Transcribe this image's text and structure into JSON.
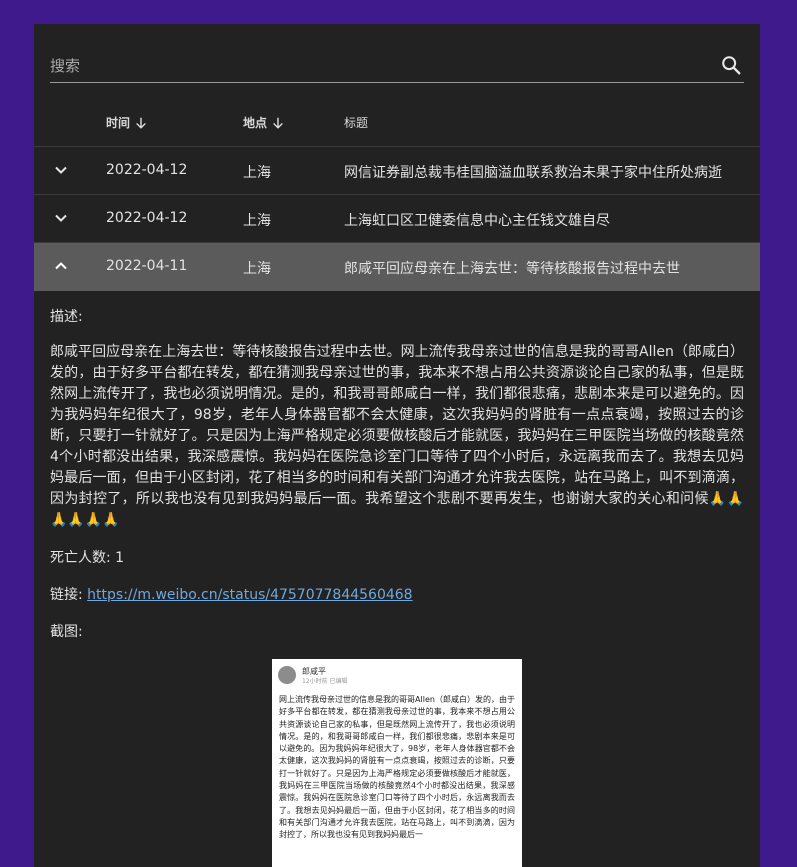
{
  "search": {
    "placeholder": "搜索"
  },
  "table": {
    "columns": {
      "time": "时间",
      "place": "地点",
      "title": "标题"
    },
    "rows": [
      {
        "date": "2022-04-12",
        "place": "上海",
        "title": "网信证券副总裁韦桂国脑溢血联系救治未果于家中住所处病逝",
        "expanded": false
      },
      {
        "date": "2022-04-12",
        "place": "上海",
        "title": "上海虹口区卫健委信息中心主任钱文雄自尽",
        "expanded": false
      },
      {
        "date": "2022-04-11",
        "place": "上海",
        "title": "郎咸平回应母亲在上海去世：等待核酸报告过程中去世",
        "expanded": true
      }
    ]
  },
  "detail": {
    "desc_label": "描述:",
    "description": "郎咸平回应母亲在上海去世：等待核酸报告过程中去世。网上流传我母亲过世的信息是我的哥哥Allen（郎咸白）发的，由于好多平台都在转发，都在猜测我母亲过世的事，我本来不想占用公共资源谈论自己家的私事，但是既然网上流传开了，我也必须说明情况。是的，和我哥哥郎咸白一样，我们都很悲痛，悲剧本来是可以避免的。因为我妈妈年纪很大了，98岁，老年人身体器官都不会太健康，这次我妈妈的肾脏有一点点衰竭，按照过去的诊断，只要打一针就好了。只是因为上海严格规定必须要做核酸后才能就医，我妈妈在三甲医院当场做的核酸竟然4个小时都没出结果，我深感震惊。我妈妈在医院急诊室门口等待了四个小时后，永远离我而去了。我想去见妈妈最后一面，但由于小区封闭，花了相当多的时间和有关部门沟通才允许我去医院，站在马路上，叫不到滴滴，因为封控了，所以我也没有见到我妈妈最后一面。我希望这个悲剧不要再发生，也谢谢大家的关心和问候🙏🙏🙏🙏🙏🙏",
    "deaths": "死亡人数: 1",
    "link_label": "链接: ",
    "link_url": "https://m.weibo.cn/status/4757077844560468",
    "screenshot_label": "截图:",
    "screenshot": {
      "username": "郎咸平",
      "meta": "12小时前 已编辑",
      "text": "网上流传我母亲过世的信息是我的哥哥Allen（郎咸白）发的，由于好多平台都在转发，都在猜测我母亲过世的事，我本来不想占用公共资源谈论自己家的私事，但是既然网上流传开了，我也必须说明情况。是的，和我哥哥郎咸白一样，我们都很悲痛，悲剧本来是可以避免的。因为我妈妈年纪很大了，98岁，老年人身体器官都不会太健康，这次我妈妈的肾脏有一点点衰竭，按照过去的诊断，只要打一针就好了。只是因为上海严格规定必须要做核酸后才能就医，我妈妈在三甲医院当场做的核酸竟然4个小时都没出结果，我深感震惊。我妈妈在医院急诊室门口等待了四个小时后，永远离我而去了。我想去见妈妈最后一面，但由于小区封闭，花了相当多的时间和有关部门沟通才允许我去医院，站在马路上，叫不到滴滴，因为封控了，所以我也没有见到我妈妈最后一"
    }
  },
  "colors": {
    "background": "#3f1a8c",
    "panel": "#222222",
    "expanded_row": "#5b5b5b",
    "link": "#6fa8dc"
  }
}
